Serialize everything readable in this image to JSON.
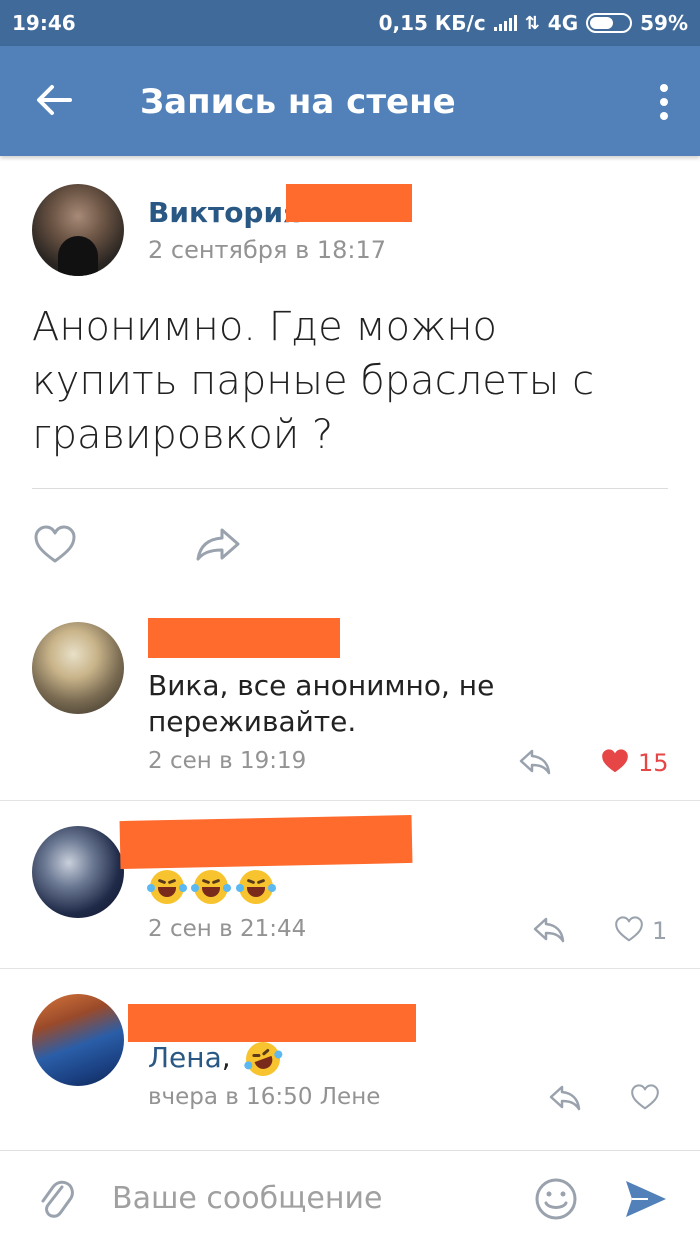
{
  "status_bar": {
    "time": "19:46",
    "speed": "0,15 КБ/с",
    "network": "4G",
    "battery": "59%",
    "battery_level": 0.59
  },
  "header": {
    "title": "Запись на стене"
  },
  "post": {
    "author_name": "Виктория",
    "date": "2 сентября в 18:17",
    "text": "Анонимно. Где можно купить парные браслеты с гравировкой ?"
  },
  "comments": [
    {
      "text": "Вика, все анонимно, не переживайте.",
      "date": "2 сен в 19:19",
      "likes": "15",
      "liked": true
    },
    {
      "emoji_count": 3,
      "date": "2 сен в 21:44",
      "likes": "1",
      "liked": false
    },
    {
      "reply_to": "Лена",
      "reply_suffix": ",",
      "date": "вчера в 16:50 Лене",
      "likes": "",
      "liked": false
    }
  ],
  "composer": {
    "placeholder": "Ваше сообщение"
  },
  "colors": {
    "header": "#5181b8",
    "status_bar": "#3f6a99",
    "link": "#2a5885",
    "redaction": "#ff6a2d",
    "like_active": "#e64646",
    "icon": "#99a2ad"
  }
}
